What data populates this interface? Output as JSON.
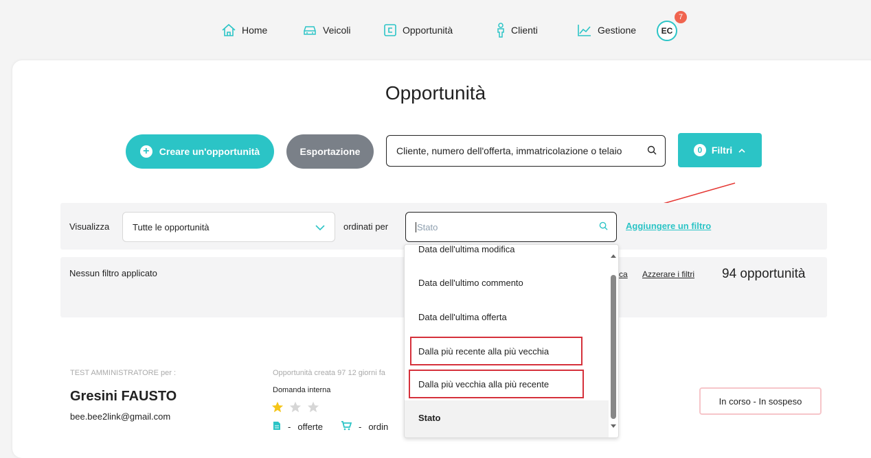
{
  "nav": {
    "home": "Home",
    "vehicles": "Veicoli",
    "opportunities": "Opportunità",
    "clients": "Clienti",
    "management": "Gestione",
    "avatar": "EC",
    "notifications": "7"
  },
  "page": {
    "title": "Opportunità"
  },
  "toolbar": {
    "create_label": "Creare un'opportunità",
    "export_label": "Esportazione",
    "search_placeholder": "Cliente, numero dell'offerta, immatricolazione o telaio",
    "filter_count": "0",
    "filter_label": "Filtri"
  },
  "filters": {
    "view_label": "Visualizza",
    "view_value": "Tutte le opportunità",
    "sort_label": "ordinati per",
    "sort_placeholder": "Stato",
    "add_filter": "Aggiungere un filtro",
    "no_filter": "Nessun filtro applicato",
    "search_link_partial": "rca",
    "reset_link": "Azzerare i filtri",
    "result_count": "94 opportunità"
  },
  "dropdown": {
    "options": [
      "Data dell'ultima modifica",
      "Data dell'ultimo commento",
      "Data dell'ultima offerta",
      "Dalla più recente alla più vecchia",
      "Dalla più vecchia alla più recente",
      "Stato"
    ],
    "selected": "Stato"
  },
  "opportunity": {
    "owner": "TEST AMMINISTRATORE per :",
    "client_name": "Gresini FAUSTO",
    "email": "bee.bee2link@gmail.com",
    "created": "Opportunità creata 97 12 giorni fa",
    "request_type": "Domanda interna",
    "rating": 1,
    "rating_max": 3,
    "offers_label": "offerte",
    "orders_label": "ordin",
    "dash": "-",
    "status": "In corso - In sospeso"
  },
  "colors": {
    "accent": "#2bc4c6",
    "export_grey": "#7a8088",
    "badge_red": "#f0644f",
    "highlight_red": "#d5303a",
    "star_yellow": "#f5c518"
  }
}
